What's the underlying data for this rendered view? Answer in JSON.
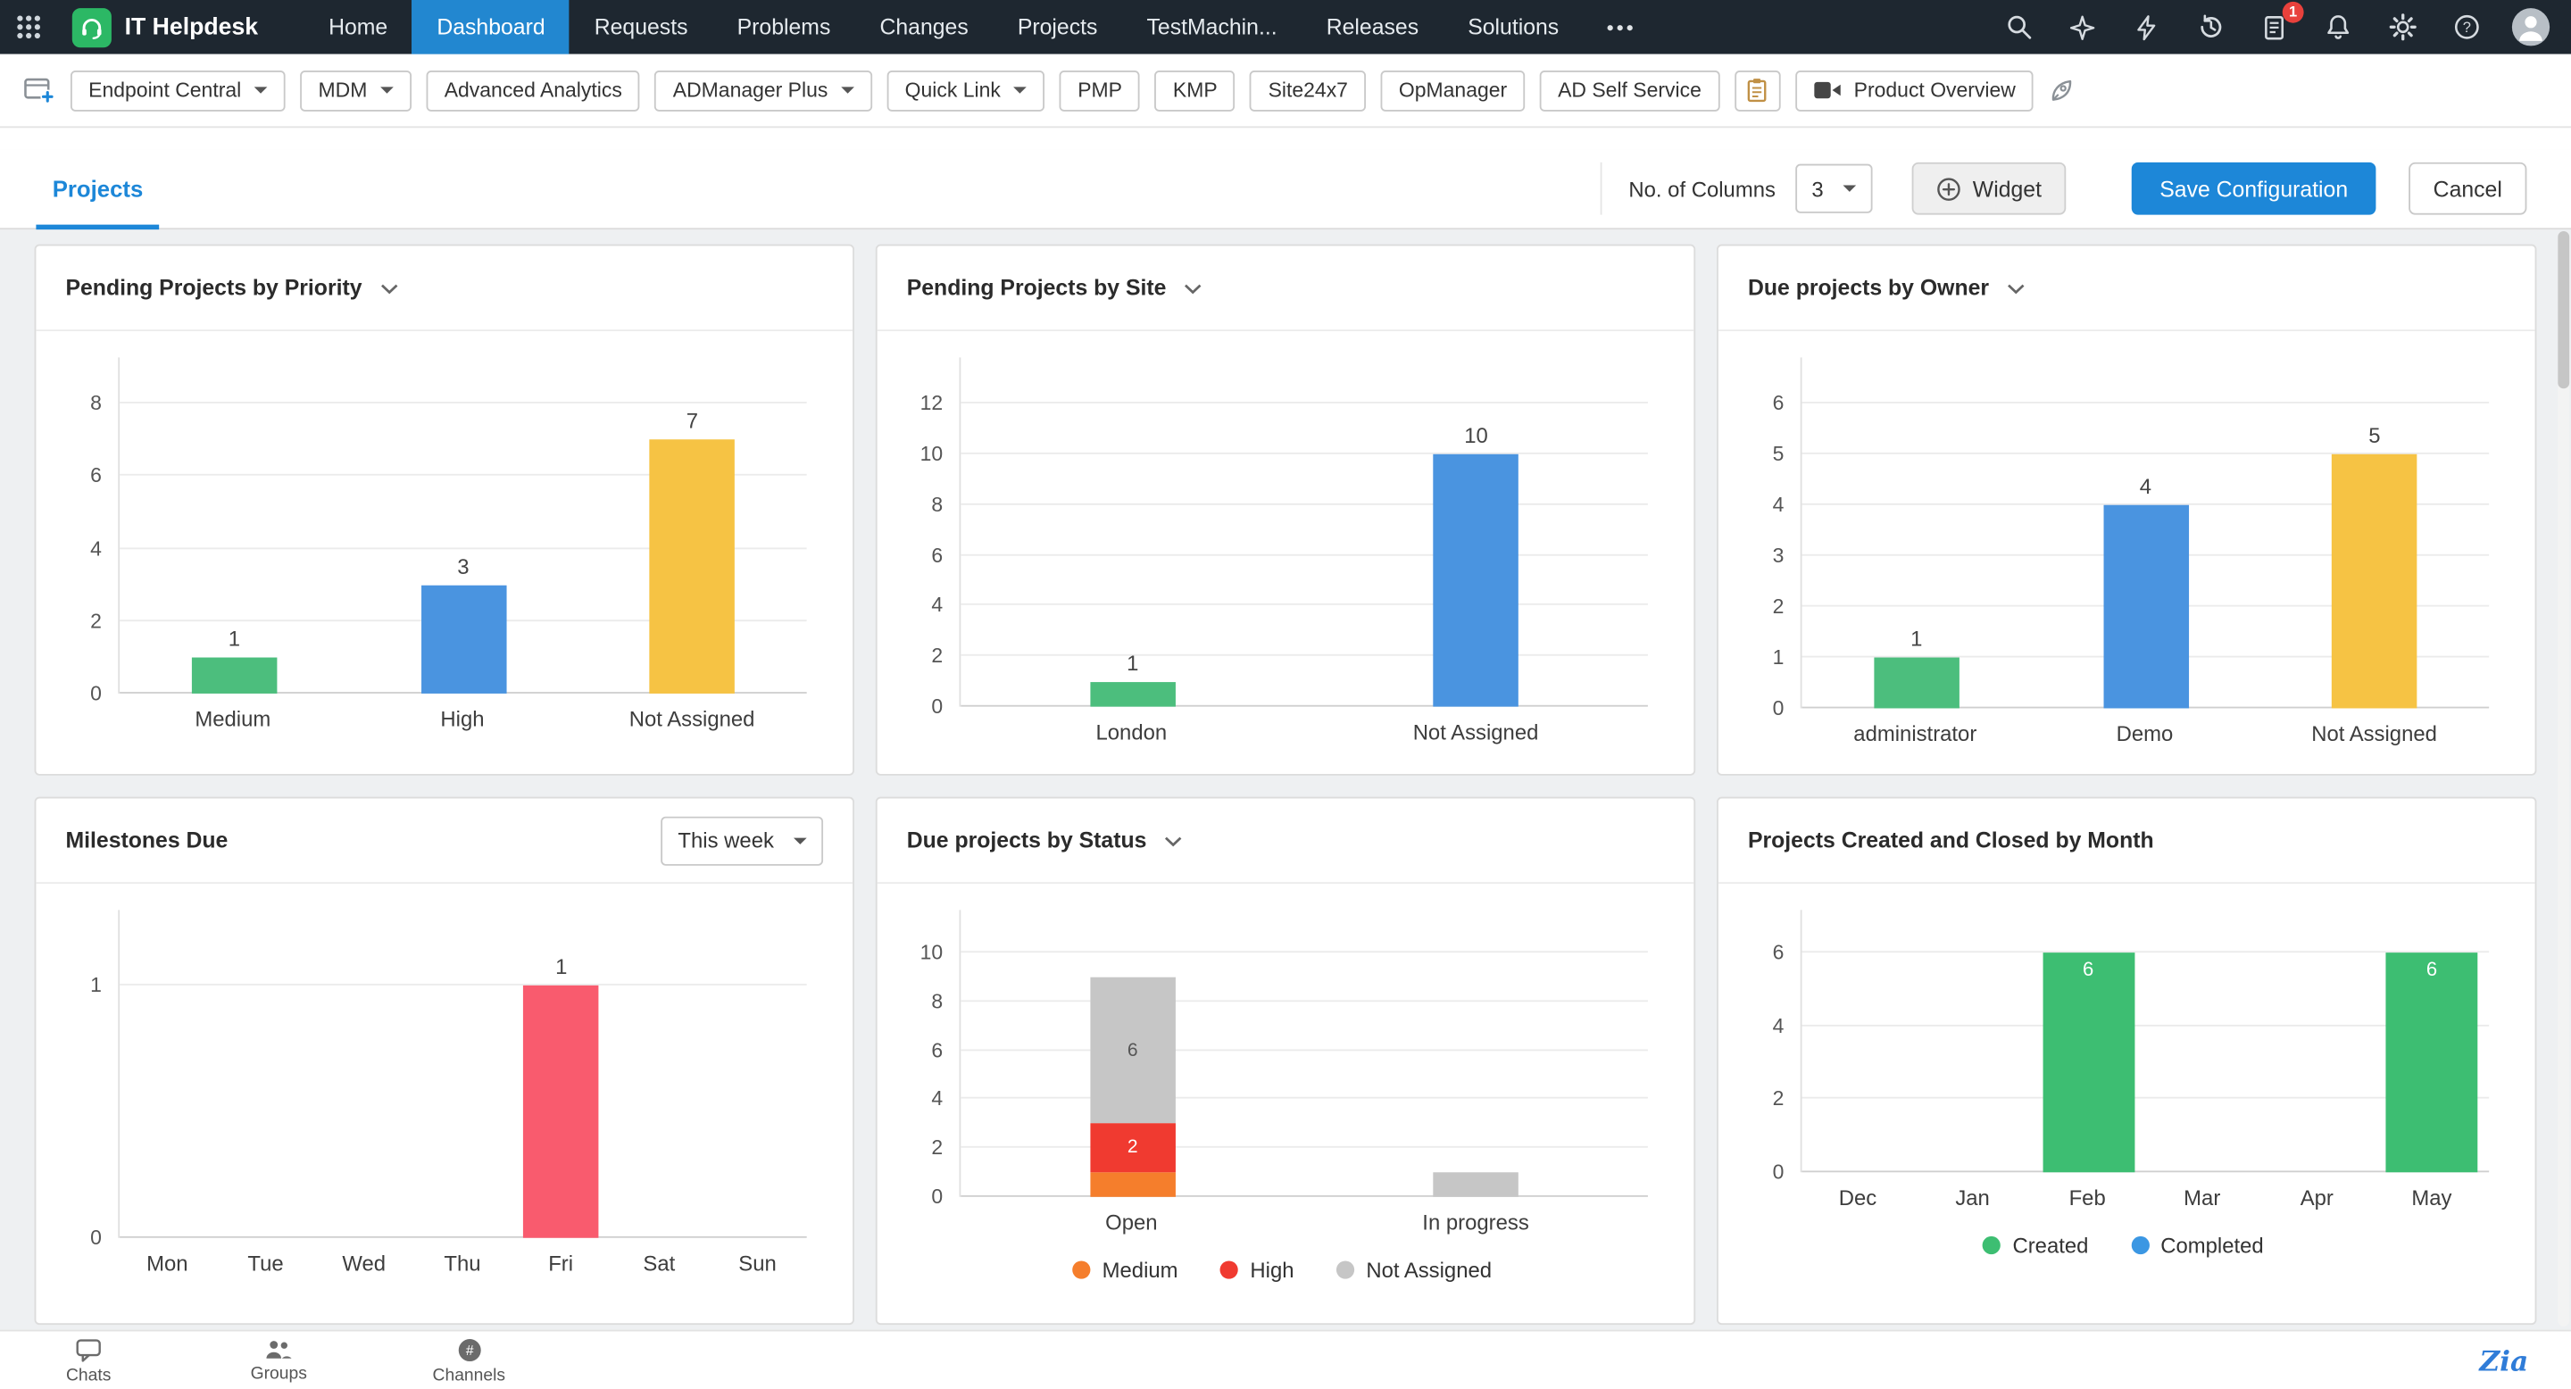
{
  "colors": {
    "accent_blue": "#1D87D8",
    "navbar_bg": "#1E2730",
    "active_nav_bg": "#2287D0",
    "logo_green": "#2CB865",
    "badge_red": "#E8413C",
    "bar_green": "#4CBE7D",
    "bar_blue": "#4A94E0",
    "bar_yellow": "#F6C344",
    "bar_red": "#F95B6E",
    "stack_orange": "#F57E2C",
    "stack_red": "#F03A30",
    "stack_gray": "#C6C6C6",
    "created_green": "#3DBE72",
    "completed_blue": "#3B97E3"
  },
  "navbar": {
    "brand": "IT Helpdesk",
    "items": [
      {
        "label": "Home",
        "active": false
      },
      {
        "label": "Dashboard",
        "active": true
      },
      {
        "label": "Requests",
        "active": false
      },
      {
        "label": "Problems",
        "active": false
      },
      {
        "label": "Changes",
        "active": false
      },
      {
        "label": "Projects",
        "active": false
      },
      {
        "label": "TestMachin...",
        "active": false
      },
      {
        "label": "Releases",
        "active": false
      },
      {
        "label": "Solutions",
        "active": false
      }
    ],
    "right_icons": [
      "search-icon",
      "sparkle-icon",
      "lightning-icon",
      "history-icon",
      "feedback-icon",
      "notification-bell-icon",
      "settings-gear-icon",
      "help-icon",
      "user-avatar"
    ],
    "badge_count": "1"
  },
  "toolbar": {
    "buttons": [
      {
        "label": "Endpoint Central",
        "caret": true
      },
      {
        "label": "MDM",
        "caret": true
      },
      {
        "label": "Advanced Analytics",
        "caret": false
      },
      {
        "label": "ADManager Plus",
        "caret": true
      },
      {
        "label": "Quick Link",
        "caret": true
      },
      {
        "label": "PMP",
        "caret": false
      },
      {
        "label": "KMP",
        "caret": false
      },
      {
        "label": "Site24x7",
        "caret": false
      },
      {
        "label": "OpManager",
        "caret": false
      },
      {
        "label": "AD Self Service",
        "caret": false
      }
    ],
    "product_overview_label": "Product Overview"
  },
  "tabbar": {
    "tab": "Projects",
    "columns_label": "No. of Columns",
    "columns_value": "3",
    "widget_button": "Widget",
    "save_button": "Save Configuration",
    "cancel_button": "Cancel"
  },
  "widgets": [
    {
      "title": "Pending Projects by Priority",
      "chart_data": {
        "type": "bar",
        "categories": [
          "Medium",
          "High",
          "Not Assigned"
        ],
        "values": [
          1,
          3,
          7
        ],
        "colors": [
          "#4CBE7D",
          "#4A94E0",
          "#F6C344"
        ],
        "yticks": [
          0,
          2,
          4,
          6,
          8
        ],
        "ylim": [
          0,
          8
        ],
        "grid": true,
        "value_labels": "above"
      }
    },
    {
      "title": "Pending Projects by Site",
      "chart_data": {
        "type": "bar",
        "categories": [
          "London",
          "Not Assigned"
        ],
        "values": [
          1,
          10
        ],
        "colors": [
          "#4CBE7D",
          "#4A94E0"
        ],
        "yticks": [
          0,
          2,
          4,
          6,
          8,
          10,
          12
        ],
        "ylim": [
          0,
          12
        ],
        "grid": true,
        "value_labels": "above"
      }
    },
    {
      "title": "Due projects by Owner",
      "chart_data": {
        "type": "bar",
        "categories": [
          "administrator",
          "Demo",
          "Not Assigned"
        ],
        "values": [
          1,
          4,
          5
        ],
        "colors": [
          "#4CBE7D",
          "#4A94E0",
          "#F6C344"
        ],
        "yticks": [
          0,
          1,
          2,
          3,
          4,
          5,
          6
        ],
        "ylim": [
          0,
          6
        ],
        "grid": true,
        "value_labels": "above"
      }
    },
    {
      "title": "Milestones Due",
      "filter_value": "This week",
      "chart_data": {
        "type": "bar",
        "categories": [
          "Mon",
          "Tue",
          "Wed",
          "Thu",
          "Fri",
          "Sat",
          "Sun"
        ],
        "values": [
          0,
          0,
          0,
          0,
          1,
          0,
          0
        ],
        "colors": [
          "#F95B6E",
          "#F95B6E",
          "#F95B6E",
          "#F95B6E",
          "#F95B6E",
          "#F95B6E",
          "#F95B6E"
        ],
        "yticks": [
          0,
          1
        ],
        "ylim": [
          0,
          1
        ],
        "grid": true,
        "value_labels": "above"
      }
    },
    {
      "title": "Due projects by Status",
      "chart_data": {
        "type": "stacked-bar",
        "categories": [
          "Open",
          "In progress"
        ],
        "series": [
          {
            "name": "Medium",
            "color": "#F57E2C",
            "values": [
              1,
              0
            ]
          },
          {
            "name": "High",
            "color": "#F03A30",
            "values": [
              2,
              0
            ]
          },
          {
            "name": "Not Assigned",
            "color": "#C6C6C6",
            "values": [
              6,
              1
            ]
          }
        ],
        "yticks": [
          0,
          2,
          4,
          6,
          8,
          10
        ],
        "ylim": [
          0,
          10
        ],
        "grid": true,
        "legend": true,
        "legend_position": "bottom"
      }
    },
    {
      "title": "Projects Created and Closed by Month",
      "chart_data": {
        "type": "grouped-bar",
        "categories": [
          "Dec",
          "Jan",
          "Feb",
          "Mar",
          "Apr",
          "May"
        ],
        "series": [
          {
            "name": "Created",
            "color": "#3DBE72",
            "values": [
              0,
              0,
              6,
              0,
              0,
              6
            ]
          },
          {
            "name": "Completed",
            "color": "#3B97E3",
            "values": [
              0,
              0,
              0,
              0,
              0,
              0
            ]
          }
        ],
        "yticks": [
          0,
          2,
          4,
          6
        ],
        "ylim": [
          0,
          6
        ],
        "grid": true,
        "legend": true,
        "legend_position": "bottom",
        "value_labels": "inside"
      }
    }
  ],
  "footer": {
    "items": [
      {
        "label": "Chats"
      },
      {
        "label": "Groups"
      },
      {
        "label": "Channels"
      }
    ],
    "zia": "Zia"
  }
}
